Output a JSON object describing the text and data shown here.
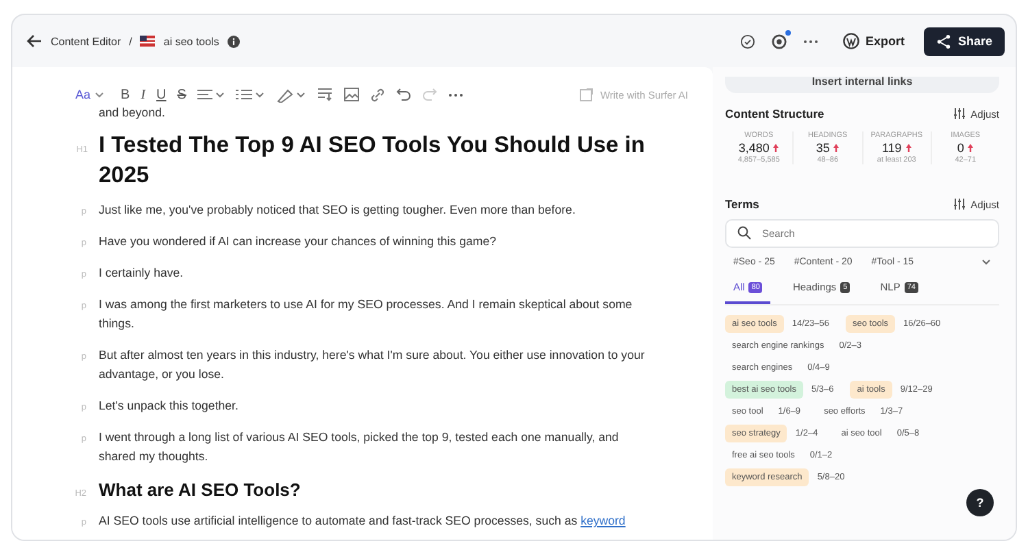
{
  "topbar": {
    "breadcrumb": "Content Editor",
    "separator": "/",
    "document": "ai seo tools",
    "export": "Export",
    "share": "Share",
    "notification": true
  },
  "toolbar": {
    "font": "Aa",
    "format": [
      "B",
      "I",
      "U",
      "S"
    ],
    "ai_button": "Write with Surfer AI"
  },
  "content": [
    {
      "kind": "p",
      "text": "and beyond."
    },
    {
      "kind": "h1",
      "marker": "H1",
      "text": "I Tested The Top 9 AI SEO Tools You Should Use in 2025"
    },
    {
      "kind": "p",
      "marker": "p",
      "text": "Just like me, you've probably noticed that SEO is getting tougher. Even more than before."
    },
    {
      "kind": "p",
      "marker": "p",
      "text": "Have you wondered if AI can increase your chances of winning this game?"
    },
    {
      "kind": "p",
      "marker": "p",
      "text": "I certainly have."
    },
    {
      "kind": "p",
      "marker": "p",
      "text": "I was among the first marketers to use AI for my SEO processes. And I remain skeptical about some things."
    },
    {
      "kind": "p",
      "marker": "p",
      "text": "But after almost ten years in this industry, here's what I'm sure about. You either use innovation to your advantage, or you lose."
    },
    {
      "kind": "p",
      "marker": "p",
      "text": "Let's unpack this together."
    },
    {
      "kind": "p",
      "marker": "p",
      "text": "I went through a long list of various AI SEO tools, picked the top 9, tested each one manually, and shared my thoughts."
    },
    {
      "kind": "h2",
      "marker": "H2",
      "text": "What are AI SEO Tools?"
    },
    {
      "kind": "p",
      "marker": "p",
      "text": "AI SEO tools use artificial intelligence to automate and fast-track SEO processes, such as",
      "link": "keyword"
    }
  ],
  "sidebar": {
    "insert_links": "Insert internal links",
    "structure": {
      "title": "Content Structure",
      "adjust": "Adjust",
      "stats": [
        {
          "label": "WORDS",
          "value": "3,480",
          "range": "4,857–5,585"
        },
        {
          "label": "HEADINGS",
          "value": "35",
          "range": "48–86"
        },
        {
          "label": "PARAGRAPHS",
          "value": "119",
          "range": "at least 203"
        },
        {
          "label": "IMAGES",
          "value": "0",
          "range": "42–71"
        }
      ]
    },
    "terms": {
      "title": "Terms",
      "adjust": "Adjust",
      "search": {
        "placeholder": "Search"
      },
      "filters": [
        "#Seo - 25",
        "#Content - 20",
        "#Tool - 15"
      ],
      "tabs": [
        {
          "label": "All",
          "count": "80",
          "selected": true
        },
        {
          "label": "Headings",
          "count": "5",
          "selected": false
        },
        {
          "label": "NLP",
          "count": "74",
          "selected": false
        }
      ],
      "items": [
        {
          "term": "ai seo tools",
          "usage": "14/23–56",
          "color": "#fde8cc"
        },
        {
          "term": "seo tools",
          "usage": "16/26–60",
          "color": "#fde8cc"
        },
        {
          "term": "search engine rankings",
          "usage": "0/2–3"
        },
        {
          "term": "search engines",
          "usage": "0/4–9"
        },
        {
          "term": "best ai seo tools",
          "usage": "5/3–6",
          "color": "#d3f2dc"
        },
        {
          "term": "ai tools",
          "usage": "9/12–29",
          "color": "#fde8cc"
        },
        {
          "term": "seo tool",
          "usage": "1/6–9"
        },
        {
          "term": "seo efforts",
          "usage": "1/3–7"
        },
        {
          "term": "seo strategy",
          "usage": "1/2–4",
          "color": "#fde8cc"
        },
        {
          "term": "ai seo tool",
          "usage": "0/5–8"
        },
        {
          "term": "free ai seo tools",
          "usage": "0/1–2"
        },
        {
          "term": "keyword research",
          "usage": "5/8–20",
          "color": "#fde8cc"
        }
      ]
    }
  },
  "help_button": "?"
}
